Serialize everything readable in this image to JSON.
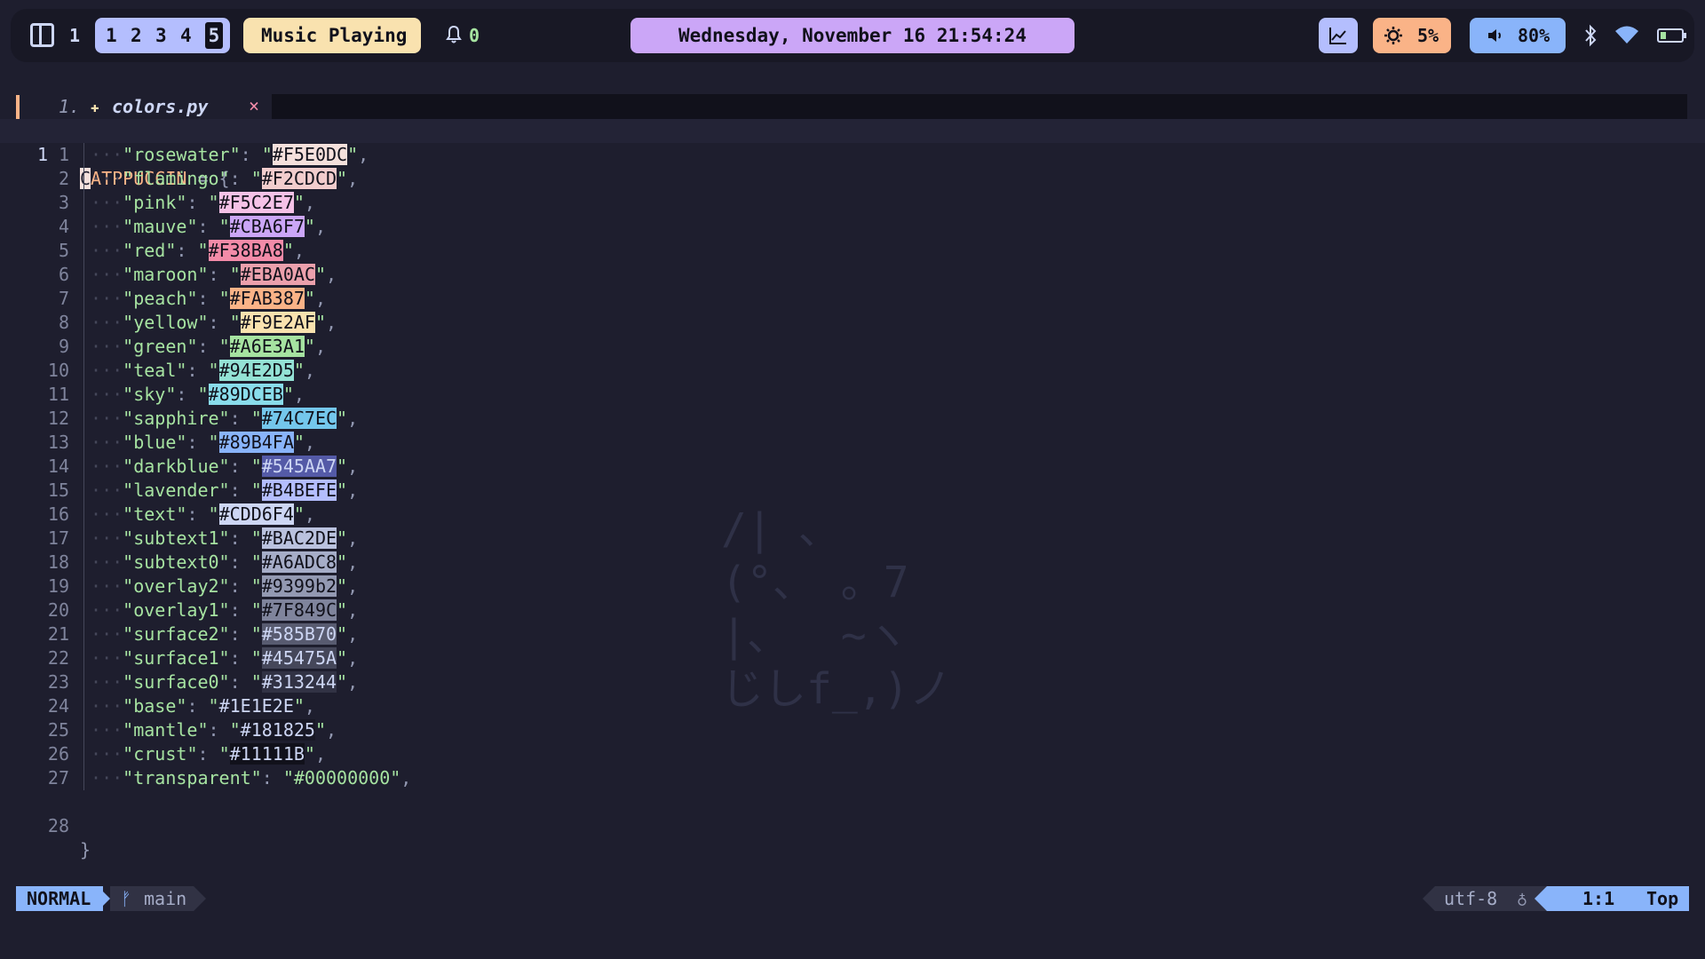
{
  "topbar": {
    "layout_index": "1",
    "workspaces": [
      "1",
      "2",
      "3",
      "4",
      "5"
    ],
    "active_workspace": "5",
    "music": "Music Playing ...",
    "notifications": "0",
    "clock": "Wednesday, November 16 21:54:24",
    "cpu": "5%",
    "volume": "80%"
  },
  "tab": {
    "number": "1.",
    "filename": "colors.py",
    "close": "×"
  },
  "editor": {
    "first_line": {
      "number": "1",
      "cursor_char": "C",
      "rest": "ATPPUCCIN",
      "assign": " = {"
    },
    "lines": [
      {
        "n": "1",
        "key": "rosewater",
        "hex": "#F5E0DC",
        "bg": "#F5E0DC",
        "fg": "#11111b"
      },
      {
        "n": "2",
        "key": "flamingo",
        "hex": "#F2CDCD",
        "bg": "#F2CDCD",
        "fg": "#11111b"
      },
      {
        "n": "3",
        "key": "pink",
        "hex": "#F5C2E7",
        "bg": "#F5C2E7",
        "fg": "#11111b"
      },
      {
        "n": "4",
        "key": "mauve",
        "hex": "#CBA6F7",
        "bg": "#CBA6F7",
        "fg": "#11111b"
      },
      {
        "n": "5",
        "key": "red",
        "hex": "#F38BA8",
        "bg": "#F38BA8",
        "fg": "#11111b"
      },
      {
        "n": "6",
        "key": "maroon",
        "hex": "#EBA0AC",
        "bg": "#EBA0AC",
        "fg": "#11111b"
      },
      {
        "n": "7",
        "key": "peach",
        "hex": "#FAB387",
        "bg": "#FAB387",
        "fg": "#11111b"
      },
      {
        "n": "8",
        "key": "yellow",
        "hex": "#F9E2AF",
        "bg": "#F9E2AF",
        "fg": "#11111b"
      },
      {
        "n": "9",
        "key": "green",
        "hex": "#A6E3A1",
        "bg": "#A6E3A1",
        "fg": "#11111b"
      },
      {
        "n": "10",
        "key": "teal",
        "hex": "#94E2D5",
        "bg": "#94E2D5",
        "fg": "#11111b"
      },
      {
        "n": "11",
        "key": "sky",
        "hex": "#89DCEB",
        "bg": "#89DCEB",
        "fg": "#11111b"
      },
      {
        "n": "12",
        "key": "sapphire",
        "hex": "#74C7EC",
        "bg": "#74C7EC",
        "fg": "#11111b"
      },
      {
        "n": "13",
        "key": "blue",
        "hex": "#89B4FA",
        "bg": "#89B4FA",
        "fg": "#11111b"
      },
      {
        "n": "14",
        "key": "darkblue",
        "hex": "#545AA7",
        "bg": "#545AA7",
        "fg": "#cdd6f4"
      },
      {
        "n": "15",
        "key": "lavender",
        "hex": "#B4BEFE",
        "bg": "#B4BEFE",
        "fg": "#11111b"
      },
      {
        "n": "16",
        "key": "text",
        "hex": "#CDD6F4",
        "bg": "#CDD6F4",
        "fg": "#11111b"
      },
      {
        "n": "17",
        "key": "subtext1",
        "hex": "#BAC2DE",
        "bg": "#BAC2DE",
        "fg": "#11111b"
      },
      {
        "n": "18",
        "key": "subtext0",
        "hex": "#A6ADC8",
        "bg": "#A6ADC8",
        "fg": "#11111b"
      },
      {
        "n": "19",
        "key": "overlay2",
        "hex": "#9399b2",
        "bg": "#9399b2",
        "fg": "#11111b"
      },
      {
        "n": "20",
        "key": "overlay1",
        "hex": "#7F849C",
        "bg": "#7F849C",
        "fg": "#11111b"
      },
      {
        "n": "21",
        "key": "surface2",
        "hex": "#585B70",
        "bg": "#585B70",
        "fg": "#cdd6f4"
      },
      {
        "n": "22",
        "key": "surface1",
        "hex": "#45475A",
        "bg": "#45475A",
        "fg": "#cdd6f4"
      },
      {
        "n": "23",
        "key": "surface0",
        "hex": "#313244",
        "bg": "#313244",
        "fg": "#cdd6f4"
      },
      {
        "n": "24",
        "key": "base",
        "hex": "#1E1E2E",
        "bg": "#1E1E2E",
        "fg": "#cdd6f4"
      },
      {
        "n": "25",
        "key": "mantle",
        "hex": "#181825",
        "bg": "#181825",
        "fg": "#cdd6f4"
      },
      {
        "n": "26",
        "key": "crust",
        "hex": "#11111B",
        "bg": "#11111B",
        "fg": "#cdd6f4"
      },
      {
        "n": "27",
        "key": "transparent",
        "hex": "#00000000",
        "bg": "transparent",
        "fg": "#a6e3a1"
      }
    ],
    "last_line": {
      "number": "28",
      "text": "}"
    },
    "ascii_art": "/| 、\n(°、 。7\n|、  ~ヽ\nじしf_,)ノ"
  },
  "statusline": {
    "mode": "NORMAL",
    "branch_icon": "ᚠ",
    "branch": "main",
    "encoding": "utf-8",
    "os_icon": "♁",
    "position": "1:1",
    "scroll": "Top"
  },
  "colors": {
    "bg": "#1e1e2e",
    "bar_bg": "#181825",
    "workspace_pill": "#b4befe",
    "music_pill": "#f9e2af",
    "clock_pill": "#cba6f7",
    "cpu_pill": "#fab387",
    "volume_pill": "#89b4fa",
    "string_green": "#a6e3a1"
  },
  "icons": {
    "layout": "split-layout-icon",
    "bell": "bell-icon",
    "chart": "chart-icon",
    "cpu": "sun-gear-icon",
    "volume": "speaker-icon",
    "bluetooth": "bluetooth-icon",
    "wifi": "wifi-icon",
    "battery": "battery-icon",
    "file": "python-file-icon",
    "git": "git-branch-icon"
  }
}
